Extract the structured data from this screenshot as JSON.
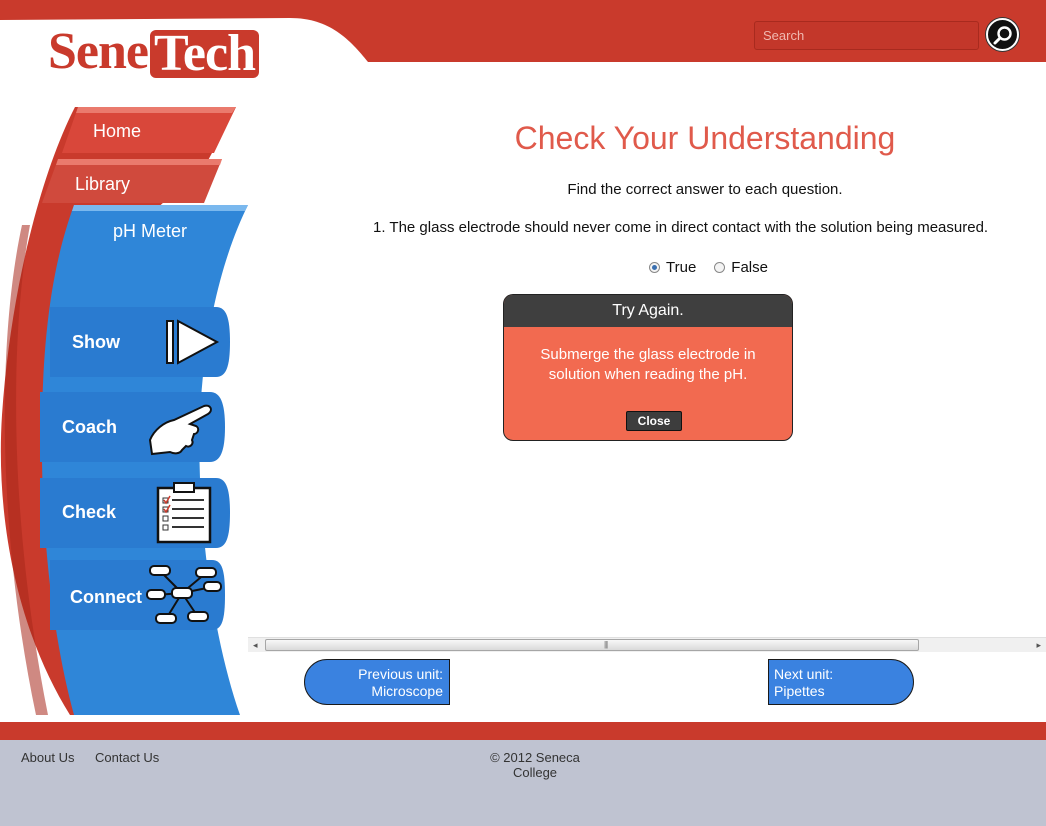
{
  "header": {
    "logo_part1": "Sene",
    "logo_part2": "Tech",
    "search_placeholder": "Search",
    "brand_color": "#c93a2c"
  },
  "sidebar": {
    "home": "Home",
    "library": "Library",
    "section": "pH Meter",
    "buttons": {
      "show": "Show",
      "coach": "Coach",
      "check": "Check",
      "connect": "Connect"
    },
    "accent_color": "#2f86d8"
  },
  "main": {
    "title": "Check Your Understanding",
    "instructions": "Find the correct answer to each question.",
    "question": "1. The glass electrode should never come in direct contact with the solution being measured.",
    "options": [
      {
        "label": "True",
        "selected": true
      },
      {
        "label": "False",
        "selected": false
      }
    ]
  },
  "dialog": {
    "title": "Try Again.",
    "message": "Submerge the glass electrode in solution when reading the pH.",
    "close_label": "Close"
  },
  "navigation": {
    "prev_line1": "Previous unit:",
    "prev_line2": "Microscope",
    "next_line1": "Next unit:",
    "next_line2": "Pipettes"
  },
  "footer": {
    "about": "About Us",
    "contact": "Contact Us",
    "copyright_line1": "© 2012 Seneca",
    "copyright_line2": "College"
  }
}
